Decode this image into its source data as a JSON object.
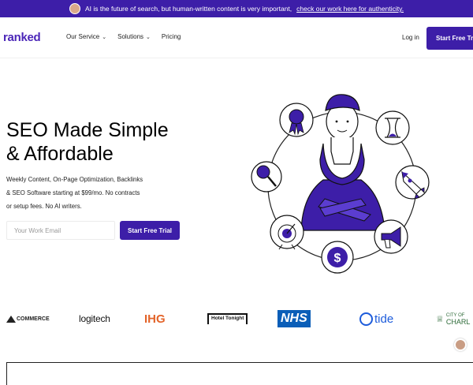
{
  "banner": {
    "text": "AI is the future of search, but human-written content is very important,",
    "link": "check our work here for authenticity."
  },
  "nav": {
    "logo": "ranked",
    "items": [
      {
        "label": "Our Service",
        "has_dropdown": true
      },
      {
        "label": "Solutions",
        "has_dropdown": true
      },
      {
        "label": "Pricing",
        "has_dropdown": false
      }
    ],
    "login": "Log in",
    "cta": "Start Free Trial"
  },
  "hero": {
    "title_line1": "SEO Made Simple",
    "title_line2": "& Affordable",
    "desc_line1": "Weekly Content, On-Page Optimization, Backlinks",
    "desc_line2": "& SEO Software starting at $99/mo. No contracts",
    "desc_line3": "or setup fees. No AI writers.",
    "email_placeholder": "Your Work Email",
    "cta": "Start Free Trial"
  },
  "illustration": {
    "icons": [
      "award-icon",
      "hourglass-icon",
      "magnifier-icon",
      "rocket-icon",
      "target-icon",
      "megaphone-icon",
      "dollar-icon"
    ],
    "dollar_symbol": "$"
  },
  "logos": {
    "bigcommerce": "COMMERCE",
    "logitech": "logitech",
    "ihg": "IHG",
    "hoteltonight": "Hotel Tonight",
    "nhs": "NHS",
    "tide": "tide",
    "city_small": "CITY OF",
    "city_big": "CHARL"
  },
  "colors": {
    "brand": "#3d1ea8",
    "ihg": "#e3642a",
    "nhs": "#0a5eb8",
    "tide": "#1d5cdb"
  }
}
